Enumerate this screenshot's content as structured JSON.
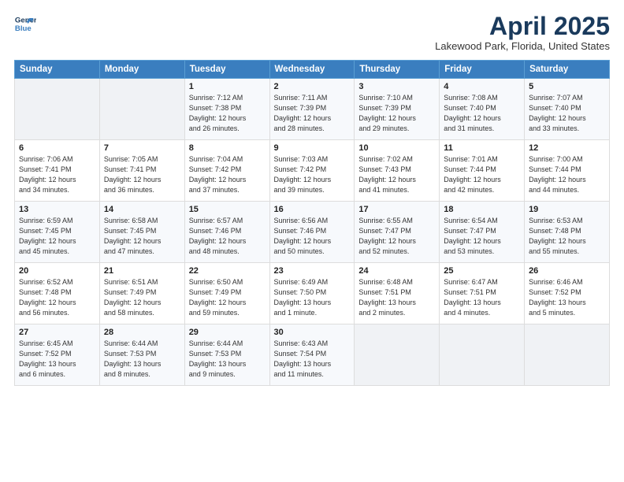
{
  "logo": {
    "line1": "General",
    "line2": "Blue",
    "icon_color": "#3a7ebf"
  },
  "title": "April 2025",
  "subtitle": "Lakewood Park, Florida, United States",
  "days_of_week": [
    "Sunday",
    "Monday",
    "Tuesday",
    "Wednesday",
    "Thursday",
    "Friday",
    "Saturday"
  ],
  "weeks": [
    [
      {
        "day": "",
        "info": ""
      },
      {
        "day": "",
        "info": ""
      },
      {
        "day": "1",
        "info": "Sunrise: 7:12 AM\nSunset: 7:38 PM\nDaylight: 12 hours\nand 26 minutes."
      },
      {
        "day": "2",
        "info": "Sunrise: 7:11 AM\nSunset: 7:39 PM\nDaylight: 12 hours\nand 28 minutes."
      },
      {
        "day": "3",
        "info": "Sunrise: 7:10 AM\nSunset: 7:39 PM\nDaylight: 12 hours\nand 29 minutes."
      },
      {
        "day": "4",
        "info": "Sunrise: 7:08 AM\nSunset: 7:40 PM\nDaylight: 12 hours\nand 31 minutes."
      },
      {
        "day": "5",
        "info": "Sunrise: 7:07 AM\nSunset: 7:40 PM\nDaylight: 12 hours\nand 33 minutes."
      }
    ],
    [
      {
        "day": "6",
        "info": "Sunrise: 7:06 AM\nSunset: 7:41 PM\nDaylight: 12 hours\nand 34 minutes."
      },
      {
        "day": "7",
        "info": "Sunrise: 7:05 AM\nSunset: 7:41 PM\nDaylight: 12 hours\nand 36 minutes."
      },
      {
        "day": "8",
        "info": "Sunrise: 7:04 AM\nSunset: 7:42 PM\nDaylight: 12 hours\nand 37 minutes."
      },
      {
        "day": "9",
        "info": "Sunrise: 7:03 AM\nSunset: 7:42 PM\nDaylight: 12 hours\nand 39 minutes."
      },
      {
        "day": "10",
        "info": "Sunrise: 7:02 AM\nSunset: 7:43 PM\nDaylight: 12 hours\nand 41 minutes."
      },
      {
        "day": "11",
        "info": "Sunrise: 7:01 AM\nSunset: 7:44 PM\nDaylight: 12 hours\nand 42 minutes."
      },
      {
        "day": "12",
        "info": "Sunrise: 7:00 AM\nSunset: 7:44 PM\nDaylight: 12 hours\nand 44 minutes."
      }
    ],
    [
      {
        "day": "13",
        "info": "Sunrise: 6:59 AM\nSunset: 7:45 PM\nDaylight: 12 hours\nand 45 minutes."
      },
      {
        "day": "14",
        "info": "Sunrise: 6:58 AM\nSunset: 7:45 PM\nDaylight: 12 hours\nand 47 minutes."
      },
      {
        "day": "15",
        "info": "Sunrise: 6:57 AM\nSunset: 7:46 PM\nDaylight: 12 hours\nand 48 minutes."
      },
      {
        "day": "16",
        "info": "Sunrise: 6:56 AM\nSunset: 7:46 PM\nDaylight: 12 hours\nand 50 minutes."
      },
      {
        "day": "17",
        "info": "Sunrise: 6:55 AM\nSunset: 7:47 PM\nDaylight: 12 hours\nand 52 minutes."
      },
      {
        "day": "18",
        "info": "Sunrise: 6:54 AM\nSunset: 7:47 PM\nDaylight: 12 hours\nand 53 minutes."
      },
      {
        "day": "19",
        "info": "Sunrise: 6:53 AM\nSunset: 7:48 PM\nDaylight: 12 hours\nand 55 minutes."
      }
    ],
    [
      {
        "day": "20",
        "info": "Sunrise: 6:52 AM\nSunset: 7:48 PM\nDaylight: 12 hours\nand 56 minutes."
      },
      {
        "day": "21",
        "info": "Sunrise: 6:51 AM\nSunset: 7:49 PM\nDaylight: 12 hours\nand 58 minutes."
      },
      {
        "day": "22",
        "info": "Sunrise: 6:50 AM\nSunset: 7:49 PM\nDaylight: 12 hours\nand 59 minutes."
      },
      {
        "day": "23",
        "info": "Sunrise: 6:49 AM\nSunset: 7:50 PM\nDaylight: 13 hours\nand 1 minute."
      },
      {
        "day": "24",
        "info": "Sunrise: 6:48 AM\nSunset: 7:51 PM\nDaylight: 13 hours\nand 2 minutes."
      },
      {
        "day": "25",
        "info": "Sunrise: 6:47 AM\nSunset: 7:51 PM\nDaylight: 13 hours\nand 4 minutes."
      },
      {
        "day": "26",
        "info": "Sunrise: 6:46 AM\nSunset: 7:52 PM\nDaylight: 13 hours\nand 5 minutes."
      }
    ],
    [
      {
        "day": "27",
        "info": "Sunrise: 6:45 AM\nSunset: 7:52 PM\nDaylight: 13 hours\nand 6 minutes."
      },
      {
        "day": "28",
        "info": "Sunrise: 6:44 AM\nSunset: 7:53 PM\nDaylight: 13 hours\nand 8 minutes."
      },
      {
        "day": "29",
        "info": "Sunrise: 6:44 AM\nSunset: 7:53 PM\nDaylight: 13 hours\nand 9 minutes."
      },
      {
        "day": "30",
        "info": "Sunrise: 6:43 AM\nSunset: 7:54 PM\nDaylight: 13 hours\nand 11 minutes."
      },
      {
        "day": "",
        "info": ""
      },
      {
        "day": "",
        "info": ""
      },
      {
        "day": "",
        "info": ""
      }
    ]
  ]
}
